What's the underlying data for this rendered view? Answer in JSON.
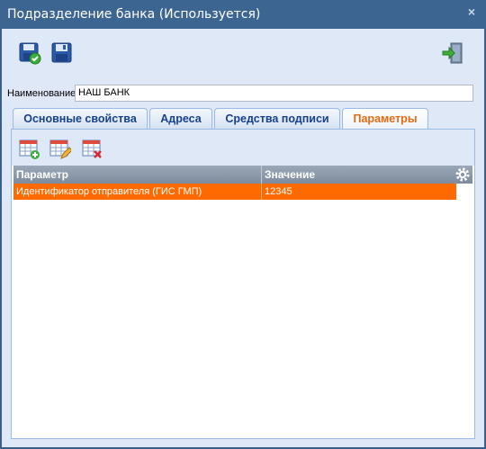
{
  "window": {
    "title": "Подразделение банка (Используется)",
    "close_glyph": "×"
  },
  "toolbar": {
    "buttons": [
      "save-and-close-icon",
      "save-icon",
      "exit-icon"
    ]
  },
  "form": {
    "name_label": "Наименование",
    "name_value": "НАШ БАНК"
  },
  "tabs": [
    {
      "label": "Основные свойства",
      "active": false
    },
    {
      "label": "Адреса",
      "active": false
    },
    {
      "label": "Средства подписи",
      "active": false
    },
    {
      "label": "Параметры",
      "active": true
    }
  ],
  "params_toolbar": {
    "icons": [
      "add-row-icon",
      "edit-row-icon",
      "delete-row-icon"
    ]
  },
  "grid": {
    "columns": [
      "Параметр",
      "Значение"
    ],
    "rows": [
      {
        "param": "Идентификатор отправителя (ГИС ГМП)",
        "value": "12345"
      }
    ],
    "selected_row_color": "#ff6a00",
    "header_icon": "gear-icon"
  }
}
